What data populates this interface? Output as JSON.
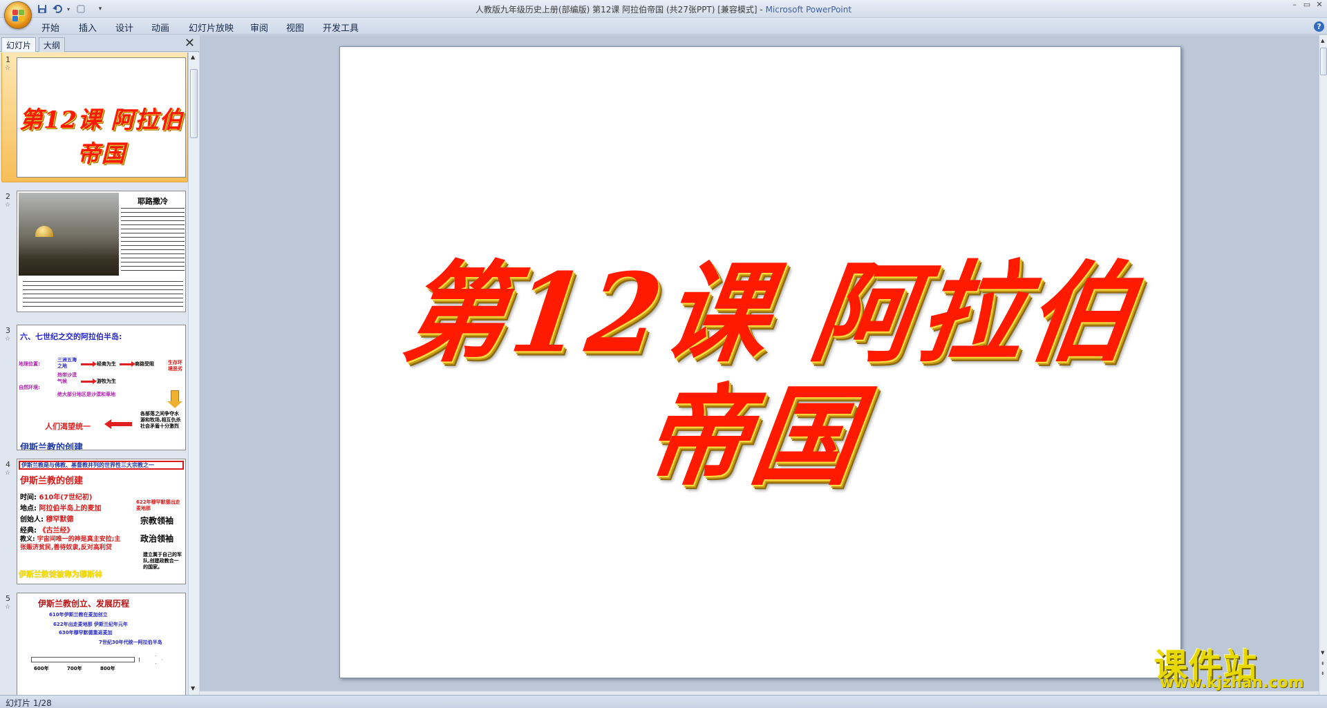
{
  "window": {
    "title_prefix": "人教版九年级历史上册(部编版) 第12课  阿拉伯帝国 (共27张PPT) [兼容模式] - ",
    "title_app": "Microsoft PowerPoint",
    "minimize": "–",
    "maximize": "▭",
    "close": "✕"
  },
  "quick_access": {
    "save_icon": "save-icon",
    "undo_icon": "undo-icon",
    "redo_icon": "redo-icon",
    "customize_icon": "▾"
  },
  "ribbon": {
    "tabs": [
      "开始",
      "插入",
      "设计",
      "动画",
      "幻灯片放映",
      "审阅",
      "视图",
      "开发工具"
    ],
    "help": "?"
  },
  "pane": {
    "tabs": [
      "幻灯片",
      "大纲"
    ],
    "close": "✕"
  },
  "slides": [
    {
      "num": "1",
      "title": "第12课 阿拉伯帝国"
    },
    {
      "num": "2",
      "heading": "耶路撒冷"
    },
    {
      "num": "3",
      "heading": "六、七世纪之交的阿拉伯半岛:",
      "labels": [
        "地理位置:",
        "自然环境:",
        "三洲五海之地",
        "热带沙漠气候",
        "绝大部分地区是沙漠和草地",
        "经商为生",
        "商路受阻",
        "游牧为生",
        "生存环境恶劣",
        "各部落之间争夺水源和牧场,相互仇杀社会矛盾十分激烈"
      ],
      "bottom_red": "人们渴望统一",
      "footer": "伊斯兰教的创建"
    },
    {
      "num": "4",
      "banner": "伊斯兰教是与佛教、基督教并列的世界性三大宗教之一",
      "heading": "伊斯兰教的创建",
      "rows": [
        {
          "label": "时间:",
          "value": "610年(7世纪初)"
        },
        {
          "label": "地点:",
          "value": "阿拉伯半岛上的麦加"
        },
        {
          "label": "创始人:",
          "value": "穆罕默德"
        },
        {
          "label": "经典:",
          "value": "《古兰经》"
        },
        {
          "label": "教义:",
          "value": "宇宙间唯一的神是真主安拉;主张赈济贫民,善待奴隶,反对高利贷"
        }
      ],
      "right_top": "622年穆罕默德出走麦地那",
      "role1": "宗教领袖",
      "role2": "政治领袖",
      "right_bottom": "建立属于自己的军队,创建政教合一的国家。",
      "yellow": "伊斯兰教徒被称为穆斯林"
    },
    {
      "num": "5",
      "heading": "伊斯兰教创立、发展历程",
      "events": [
        "610年伊斯兰教在麦加创立",
        "622年出走麦地那 伊斯兰纪年元年",
        "630年穆罕默德重返麦加",
        "7世纪30年代统一阿拉伯半岛"
      ],
      "ticks": [
        "600年",
        "700年",
        "800年"
      ]
    }
  ],
  "main": {
    "slide_title": "第12课 阿拉伯帝国"
  },
  "watermark": {
    "cn": "课件站",
    "url": "www.kjzhan.com"
  },
  "status": {
    "text": "幻灯片 1/28"
  },
  "colors": {
    "title_red": "#ff1a00",
    "title_shadow": "#f6df3e",
    "selection": "#f7be57",
    "accent_blue": "#2727c9"
  }
}
